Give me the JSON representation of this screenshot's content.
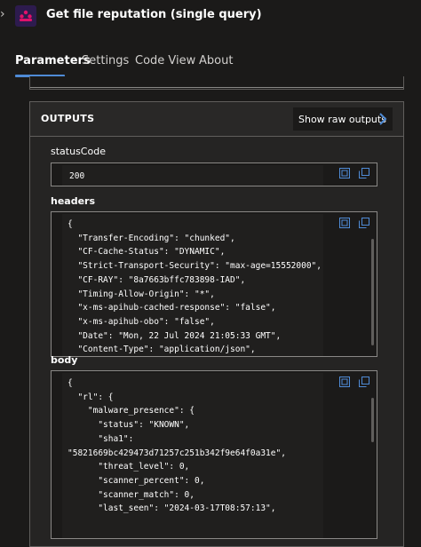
{
  "header": {
    "title": "Get file reputation (single query)",
    "icon": "reversinglabs-logo-icon",
    "accent": "#e0116a"
  },
  "tabs": [
    {
      "label": "Parameters",
      "active": true
    },
    {
      "label": "Settings",
      "active": false
    },
    {
      "label": "Code View",
      "active": false
    },
    {
      "label": "About",
      "active": false
    }
  ],
  "outputs": {
    "title": "OUTPUTS",
    "show_raw_label": "Show raw outputs",
    "status_code": {
      "label": "statusCode",
      "value": "200"
    },
    "headers": {
      "label": "headers",
      "lines": [
        "{",
        "  \"Transfer-Encoding\": \"chunked\",",
        "  \"CF-Cache-Status\": \"DYNAMIC\",",
        "  \"Strict-Transport-Security\": \"max-age=15552000\",",
        "  \"CF-RAY\": \"8a7663bffc783898-IAD\",",
        "  \"Timing-Allow-Origin\": \"*\",",
        "  \"x-ms-apihub-cached-response\": \"false\",",
        "  \"x-ms-apihub-obo\": \"false\",",
        "  \"Date\": \"Mon, 22 Jul 2024 21:05:33 GMT\",",
        "  \"Content-Type\": \"application/json\","
      ]
    },
    "body": {
      "label": "body",
      "lines": [
        "{",
        "  \"rl\": {",
        "    \"malware_presence\": {",
        "      \"status\": \"KNOWN\",",
        "      \"sha1\":",
        "\"5821669bc429473d71257c251b342f9e64f0a31e\",",
        "      \"threat_level\": 0,",
        "      \"scanner_percent\": 0,",
        "      \"scanner_match\": 0,",
        "      \"last_seen\": \"2024-03-17T08:57:13\","
      ]
    }
  },
  "icons": {
    "expand": "expand-icon",
    "copy": "copy-icon",
    "collapse": "chevron-right-icon",
    "accent_blue": "#4f8bd6"
  }
}
